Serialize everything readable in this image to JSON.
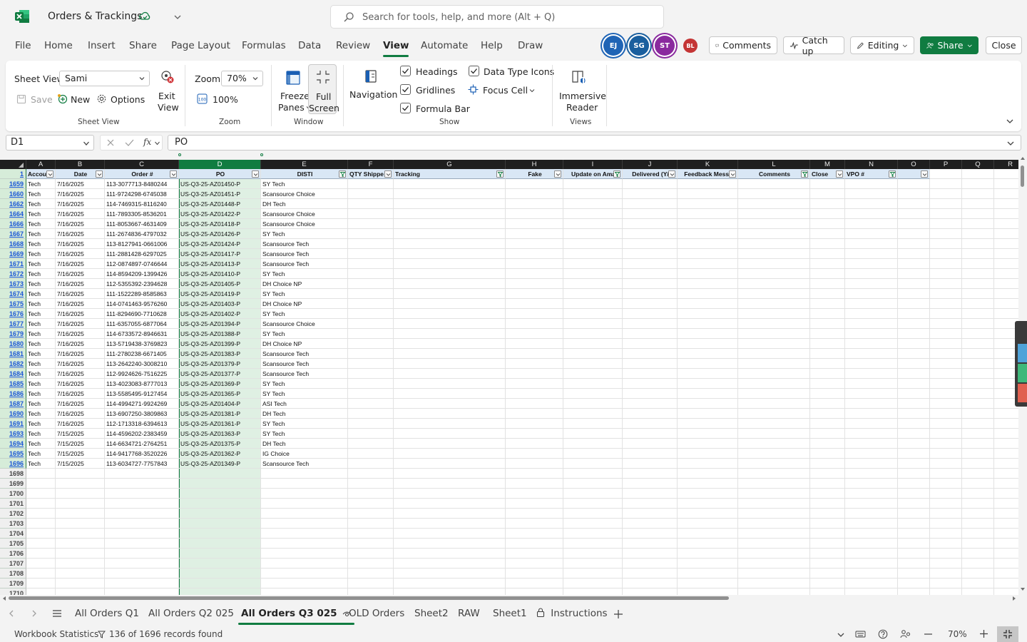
{
  "titlebar": {
    "doc_title": "Orders & Trackings",
    "search_placeholder": "Search for tools, help, and more (Alt + Q)"
  },
  "menu": {
    "tabs": [
      "File",
      "Home",
      "Insert",
      "Share",
      "Page Layout",
      "Formulas",
      "Data",
      "Review",
      "View",
      "Automate",
      "Help",
      "Draw"
    ],
    "active_tab": "View",
    "avatars": [
      {
        "initials": "EJ",
        "color": "#1f64b5"
      },
      {
        "initials": "SG",
        "color": "#1a5f9e"
      },
      {
        "initials": "ST",
        "color": "#8a2a9e"
      },
      {
        "initials": "BL",
        "color": "#c43535"
      }
    ],
    "comments_label": "Comments",
    "catchup_label": "Catch up",
    "editing_label": "Editing",
    "share_label": "Share",
    "close_label": "Close"
  },
  "ribbon": {
    "sheet_view_label": "Sheet View",
    "sheet_view_value": "Sami",
    "save_label": "Save",
    "new_label": "New",
    "options_label": "Options",
    "exit_label_1": "Exit",
    "exit_label_2": "View",
    "group_sheet_view": "Sheet View",
    "zoom_label": "Zoom",
    "zoom_value": "70%",
    "zoom_100_label": "100%",
    "group_zoom": "Zoom",
    "freeze_label_1": "Freeze",
    "freeze_label_2": "Panes",
    "fullscreen_label_1": "Full",
    "fullscreen_label_2": "Screen",
    "group_window": "Window",
    "navigation_label": "Navigation",
    "headings_label": "Headings",
    "gridlines_label": "Gridlines",
    "formula_bar_label": "Formula Bar",
    "data_type_icons_label": "Data Type Icons",
    "focus_cell_label": "Focus Cell",
    "group_show": "Show",
    "immersive_label_1": "Immersive",
    "immersive_label_2": "Reader",
    "group_views": "Views"
  },
  "formula": {
    "name_box": "D1",
    "content": "PO"
  },
  "grid": {
    "columns": [
      "A",
      "B",
      "C",
      "D",
      "E",
      "F",
      "G",
      "H",
      "I",
      "J",
      "K",
      "L",
      "M",
      "N",
      "O",
      "P",
      "Q",
      "R"
    ],
    "selected_column": "D",
    "header_row_number": "1",
    "headers": [
      "Accou",
      "Date",
      "Order #",
      "PO",
      "DISTI",
      "QTY Shippe",
      "Tracking",
      "Fake",
      "Update on Ama",
      "Delivered (Y/",
      "Feedback Messa",
      "Comments",
      "Close",
      "VPO #",
      "",
      "",
      "",
      ""
    ],
    "rows": [
      [
        "1659",
        "Tech",
        "7/16/2025",
        "113-3077713-8480244",
        "US-Q3-25-AZ01450-P",
        "SY Tech"
      ],
      [
        "1660",
        "Tech",
        "7/16/2025",
        "111-9724298-6745038",
        "US-Q3-25-AZ01451-P",
        "Scansource Choice"
      ],
      [
        "1662",
        "Tech",
        "7/16/2025",
        "114-7469315-8116240",
        "US-Q3-25-AZ01448-P",
        "DH Tech"
      ],
      [
        "1664",
        "Tech",
        "7/16/2025",
        "111-7893305-8536201",
        "US-Q3-25-AZ01422-P",
        "Scansource Choice"
      ],
      [
        "1666",
        "Tech",
        "7/16/2025",
        "111-8053667-4631409",
        "US-Q3-25-AZ01418-P",
        "Scansource Choice"
      ],
      [
        "1667",
        "Tech",
        "7/16/2025",
        "111-2674836-4797032",
        "US-Q3-25-AZ01426-P",
        "SY Tech"
      ],
      [
        "1668",
        "Tech",
        "7/16/2025",
        "113-8127941-0661006",
        "US-Q3-25-AZ01424-P",
        "Scansource Tech"
      ],
      [
        "1669",
        "Tech",
        "7/16/2025",
        "111-2881428-6297025",
        "US-Q3-25-AZ01417-P",
        "Scansource Tech"
      ],
      [
        "1671",
        "Tech",
        "7/16/2025",
        "112-0874897-0746644",
        "US-Q3-25-AZ01413-P",
        "Scansource Tech"
      ],
      [
        "1672",
        "Tech",
        "7/16/2025",
        "114-8594209-1399426",
        "US-Q3-25-AZ01410-P",
        "SY Tech"
      ],
      [
        "1673",
        "Tech",
        "7/16/2025",
        "112-5355392-2394628",
        "US-Q3-25-AZ01405-P",
        "DH Choice NP"
      ],
      [
        "1674",
        "Tech",
        "7/16/2025",
        "111-1522289-8585863",
        "US-Q3-25-AZ01419-P",
        "SY Tech"
      ],
      [
        "1675",
        "Tech",
        "7/16/2025",
        "114-0741463-9576260",
        "US-Q3-25-AZ01403-P",
        "DH Choice NP"
      ],
      [
        "1676",
        "Tech",
        "7/16/2025",
        "111-8294690-7710628",
        "US-Q3-25-AZ01402-P",
        "SY Tech"
      ],
      [
        "1677",
        "Tech",
        "7/16/2025",
        "111-6357055-6877064",
        "US-Q3-25-AZ01394-P",
        "Scansource Choice"
      ],
      [
        "1679",
        "Tech",
        "7/16/2025",
        "114-6733572-8946631",
        "US-Q3-25-AZ01388-P",
        "SY Tech"
      ],
      [
        "1680",
        "Tech",
        "7/16/2025",
        "113-5719438-3769823",
        "US-Q3-25-AZ01399-P",
        "DH Choice NP"
      ],
      [
        "1681",
        "Tech",
        "7/16/2025",
        "111-2780238-6671405",
        "US-Q3-25-AZ01383-P",
        "Scansource Tech"
      ],
      [
        "1682",
        "Tech",
        "7/16/2025",
        "113-2642240-3008210",
        "US-Q3-25-AZ01379-P",
        "Scansource Tech"
      ],
      [
        "1684",
        "Tech",
        "7/16/2025",
        "112-9924626-7516225",
        "US-Q3-25-AZ01377-P",
        "Scansource Tech"
      ],
      [
        "1685",
        "Tech",
        "7/16/2025",
        "113-4023083-8777013",
        "US-Q3-25-AZ01369-P",
        "SY Tech"
      ],
      [
        "1686",
        "Tech",
        "7/16/2025",
        "113-5585495-9127454",
        "US-Q3-25-AZ01365-P",
        "SY Tech"
      ],
      [
        "1687",
        "Tech",
        "7/16/2025",
        "114-4994271-9924269",
        "US-Q3-25-AZ01404-P",
        "ASI Tech"
      ],
      [
        "1690",
        "Tech",
        "7/16/2025",
        "113-6907250-3809863",
        "US-Q3-25-AZ01381-P",
        "DH Tech"
      ],
      [
        "1691",
        "Tech",
        "7/16/2025",
        "112-1713318-6394613",
        "US-Q3-25-AZ01361-P",
        "SY Tech"
      ],
      [
        "1693",
        "Tech",
        "7/15/2025",
        "114-4596202-2383459",
        "US-Q3-25-AZ01363-P",
        "SY Tech"
      ],
      [
        "1694",
        "Tech",
        "7/15/2025",
        "114-6634721-2764251",
        "US-Q3-25-AZ01375-P",
        "DH Tech"
      ],
      [
        "1695",
        "Tech",
        "7/15/2025",
        "114-9417768-3520226",
        "US-Q3-25-AZ01362-P",
        "IG Choice"
      ],
      [
        "1696",
        "Tech",
        "7/15/2025",
        "113-6034727-7757843",
        "US-Q3-25-AZ01349-P",
        "Scansource Tech"
      ]
    ],
    "empty_rows": [
      "1698",
      "1699",
      "1700",
      "1701",
      "1702",
      "1703",
      "1704",
      "1705",
      "1706",
      "1707",
      "1708",
      "1709",
      "1710"
    ]
  },
  "sheets": {
    "tabs": [
      "All Orders Q1",
      "All Orders Q2 025",
      "All Orders Q3 025",
      "OLD Orders",
      "Sheet2",
      "RAW",
      "Sheet1",
      "Instructions"
    ],
    "active_tab": "All Orders Q3 025"
  },
  "status": {
    "workbook_stats": "Workbook Statistics",
    "records": "136 of 1696 records found",
    "zoom": "70%"
  }
}
